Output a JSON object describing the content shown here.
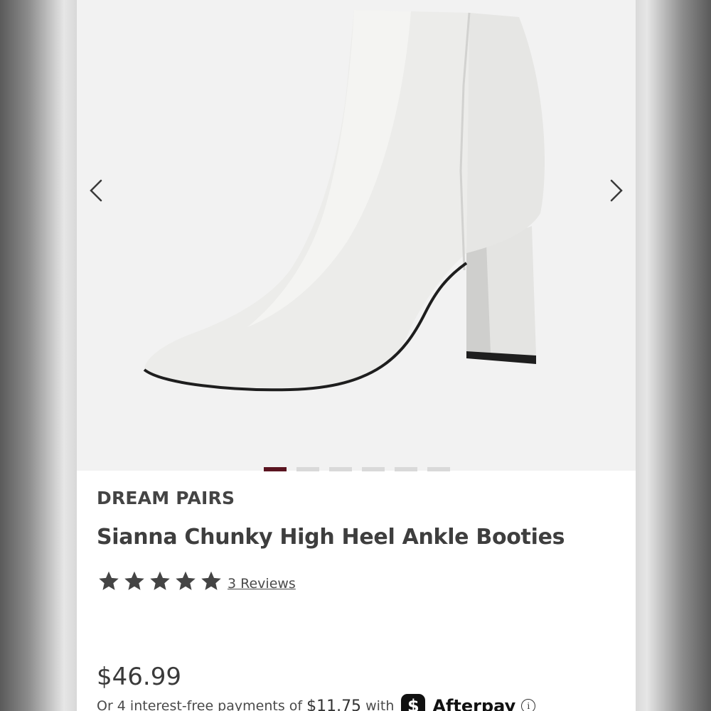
{
  "gallery": {
    "image_alt": "White pointed-toe ankle bootie with block heel",
    "slide_count": 6,
    "active_slide": 1
  },
  "product": {
    "brand": "DREAM PAIRS",
    "title": "Sianna Chunky High Heel Ankle Booties",
    "rating": 5,
    "rating_max": 5,
    "reviews_label": "3 Reviews",
    "price": "$46.99"
  },
  "payment": {
    "installment_prefix": "Or 4 interest-free payments of",
    "installment_amount": "$11.75",
    "installment_suffix": "with",
    "afterpay_badge": "$",
    "afterpay_name": "Afterpay",
    "info_icon": "i"
  },
  "colors": {
    "active_dot": "#5a1420",
    "inactive_dot": "#d9d9d9",
    "text": "#444444"
  },
  "icons": [
    "chevron-left-icon",
    "chevron-right-icon",
    "star-icon",
    "afterpay-icon",
    "info-icon"
  ]
}
